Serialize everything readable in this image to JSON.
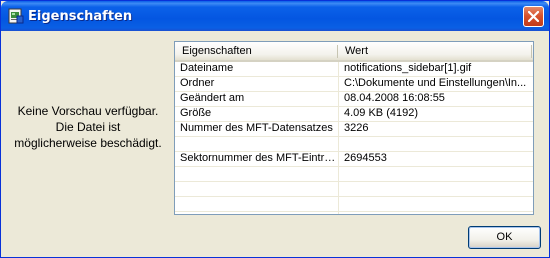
{
  "window": {
    "title": "Eigenschaften",
    "icon": "document-properties-icon",
    "close_icon": "close-icon"
  },
  "preview": {
    "lines": [
      "Keine Vorschau verfügbar.",
      "Die Datei ist",
      "möglicherweise beschädigt."
    ]
  },
  "listview": {
    "columns": [
      "Eigenschaften",
      "Wert"
    ],
    "rows": [
      {
        "name": "Dateiname",
        "value": "notifications_sidebar[1].gif"
      },
      {
        "name": "Ordner",
        "value": "C:\\Dokumente und Einstellungen\\In..."
      },
      {
        "name": "Geändert am",
        "value": "08.04.2008 16:08:55"
      },
      {
        "name": "Größe",
        "value": "4.09 KB (4192)"
      },
      {
        "name": "Nummer des MFT-Datensatzes",
        "value": "3226"
      },
      {
        "name": "",
        "value": ""
      },
      {
        "name": "Sektornummer des MFT-Eintrags",
        "value": "2694553"
      },
      {
        "name": "",
        "value": ""
      },
      {
        "name": "",
        "value": ""
      },
      {
        "name": "",
        "value": ""
      }
    ]
  },
  "buttons": {
    "ok_label": "OK"
  }
}
